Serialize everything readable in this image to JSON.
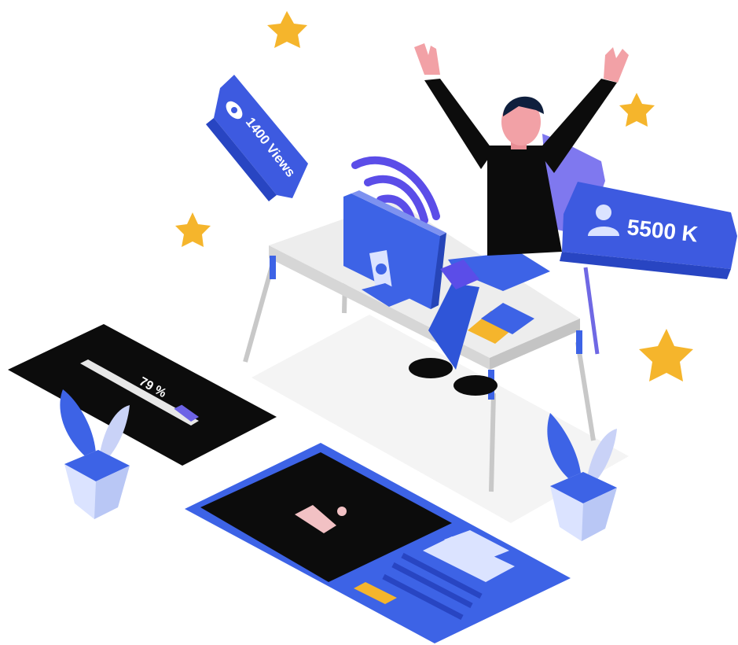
{
  "views_badge": {
    "text": "1400 Views",
    "icon": "eye-icon"
  },
  "followers_badge": {
    "text": "5500 K",
    "icon": "user-icon"
  },
  "progress_panel": {
    "label": "79 %",
    "progress": 0.79
  },
  "media_card": {
    "icon": "image-icon"
  },
  "colors": {
    "blue": "#3d63e6",
    "violet": "#5b4de8",
    "dark_panel": "#0c0c0c",
    "star": "#f5b52c",
    "desk": "#eeeeee",
    "skin": "#f2a1a6"
  }
}
